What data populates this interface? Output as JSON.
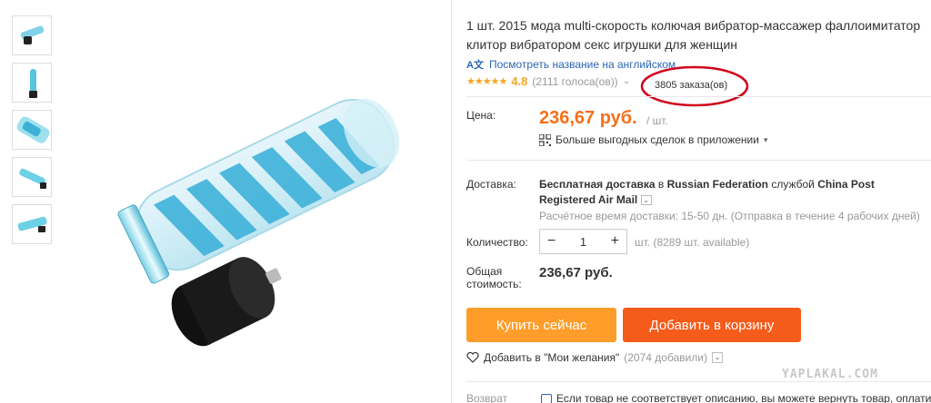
{
  "product": {
    "title": "1 шт. 2015 мода multi-скорость колючая вибратор-массажер фаллоимитатор клитор вибратором секс игрушки для женщин",
    "translate_icon": "A文",
    "translate_link": "Посмотреть название на английском",
    "stars": "★★★★★",
    "rating": "4.8",
    "votes": "(2111 голоса(ов))",
    "votes_chevron": "⌄",
    "orders": "3805 заказа(ов)"
  },
  "price": {
    "label": "Цена:",
    "value": "236,67 руб.",
    "unit": "/ шт.",
    "deals_text": "Больше выгодных сделок в приложении",
    "deals_chevron": "▾"
  },
  "shipping": {
    "label": "Доставка:",
    "text_bold_1": "Бесплатная доставка",
    "text_normal_1": " в ",
    "text_bold_2": "Russian Federation",
    "text_normal_2": " службой ",
    "text_bold_3": "China Post Registered Air Mail",
    "dropdown": "⌄",
    "eta": "Расчётное время доставки: 15-50 дн. (Отправка в течение 4 рабочих дней)"
  },
  "quantity": {
    "label": "Количество:",
    "minus": "−",
    "value": "1",
    "plus": "+",
    "available": "шт. (8289 шт. available)"
  },
  "total": {
    "label_line1": "Общая",
    "label_line2": "стоимость:",
    "value": "236,67 руб."
  },
  "buttons": {
    "buy_now": "Купить сейчас",
    "add_to_cart": "Добавить в корзину"
  },
  "wishlist": {
    "text": "Добавить в \"Мои желания\"",
    "count": "(2074 добавили)",
    "dropdown": "⌄"
  },
  "return": {
    "label": "Возврат",
    "text": "Если товар не соответствует описанию, вы можете вернуть товар, оплатив"
  },
  "watermark": "YAPLAKAL.COM",
  "colors": {
    "price": "#f5701a",
    "buy_button": "#ff9d2b",
    "cart_button": "#f55b1b",
    "stars": "#f5a623",
    "link": "#2d64b3",
    "annotation": "#d0021b"
  }
}
